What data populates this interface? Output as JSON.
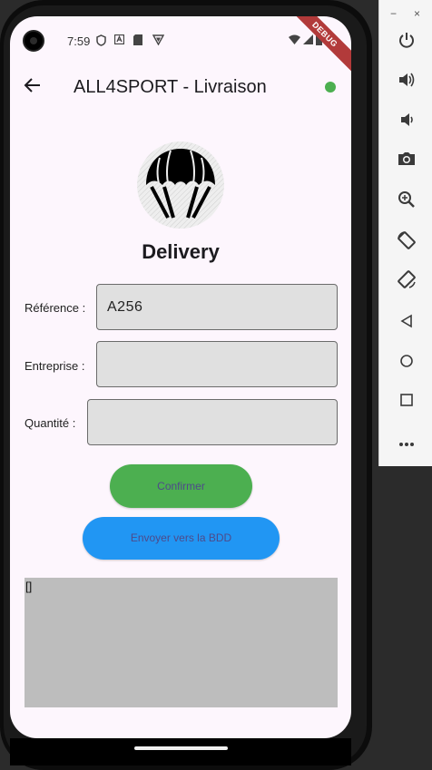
{
  "status_bar": {
    "time": "7:59",
    "icons": [
      "shield-icon",
      "a-icon",
      "sd-card-icon",
      "vpn-icon",
      "wifi-icon",
      "signal-icon",
      "battery-icon"
    ],
    "debug_banner": "DEBUG"
  },
  "app_bar": {
    "title": "ALL4SPORT - Livraison",
    "back_icon": "arrow-back-icon",
    "status_color": "#4caf50"
  },
  "heading": "Delivery",
  "form": {
    "reference": {
      "label": "Référence :",
      "value": "A256"
    },
    "entreprise": {
      "label": "Entreprise :",
      "value": ""
    },
    "quantite": {
      "label": "Quantité :",
      "value": ""
    }
  },
  "buttons": {
    "confirm": "Confirmer",
    "send": "Envoyer vers la BDD"
  },
  "output_text": "[]",
  "colors": {
    "confirm_button": "#4caf50",
    "send_button": "#2196f3",
    "button_text": "#4e4a8a",
    "output_bg": "#bdbdbd",
    "screen_bg": "#fdf6fd"
  },
  "emulator_toolbar": {
    "window_controls": [
      "minimize-icon",
      "close-icon"
    ],
    "minimize_glyph": "−",
    "close_glyph": "×",
    "buttons": [
      "power-icon",
      "volume-up-icon",
      "volume-down-icon",
      "camera-icon",
      "zoom-icon",
      "rotate-left-icon",
      "rotate-right-icon",
      "back-icon",
      "home-icon",
      "overview-icon",
      "more-icon"
    ]
  }
}
